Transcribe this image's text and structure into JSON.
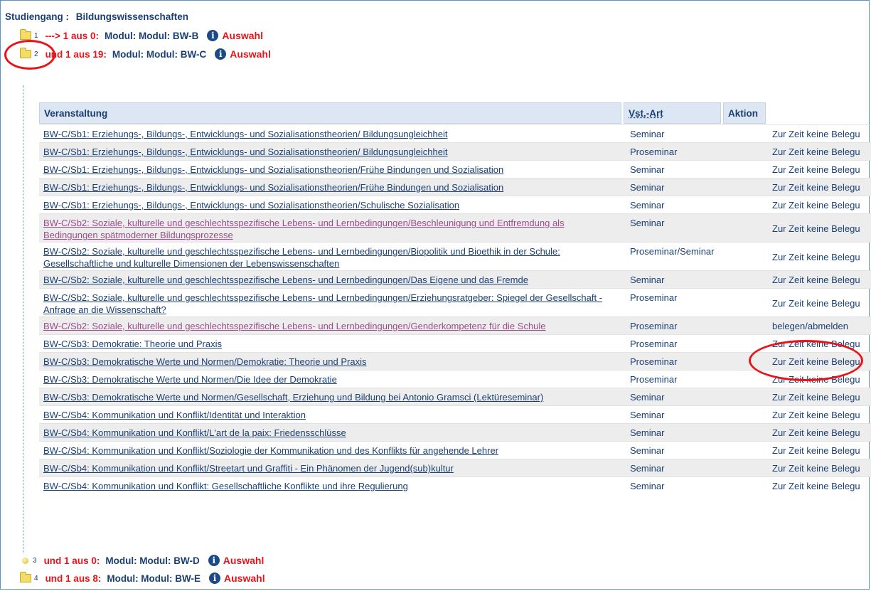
{
  "studiengang": {
    "label": "Studiengang :",
    "value": "Bildungswissenschaften"
  },
  "modules_top": [
    {
      "num": "1",
      "icon": "folder-icon",
      "condition": "---> 1 aus 0:",
      "text": "Modul:  Modul:  BW-B",
      "action": "Auswahl"
    },
    {
      "num": "2",
      "icon": "folder-icon",
      "condition": "und 1 aus 19:",
      "text": "Modul:  Modul:  BW-C",
      "action": "Auswahl"
    }
  ],
  "table": {
    "headers": {
      "veranstaltung": "Veranstaltung",
      "art": "Vst.-Art",
      "aktion": "Aktion"
    },
    "rows": [
      {
        "title": "BW-C/Sb1: Erziehungs-, Bildungs-, Entwicklungs- und Sozialisationstheorien/ Bildungsungleichheit",
        "art": "Seminar",
        "status": "Zur Zeit keine Belegu",
        "visited": false
      },
      {
        "title": "BW-C/Sb1: Erziehungs-, Bildungs-, Entwicklungs- und Sozialisationstheorien/ Bildungsungleichheit",
        "art": "Proseminar",
        "status": "Zur Zeit keine Belegu",
        "visited": false
      },
      {
        "title": "BW-C/Sb1: Erziehungs-, Bildungs-, Entwicklungs- und Sozialisationstheorien/Frühe Bindungen und Sozialisation",
        "art": "Seminar",
        "status": "Zur Zeit keine Belegu",
        "visited": false
      },
      {
        "title": "BW-C/Sb1: Erziehungs-, Bildungs-, Entwicklungs- und Sozialisationstheorien/Frühe Bindungen und Sozialisation",
        "art": "Seminar",
        "status": "Zur Zeit keine Belegu",
        "visited": false
      },
      {
        "title": "BW-C/Sb1: Erziehungs-, Bildungs-, Entwicklungs- und Sozialisationstheorien/Schulische Sozialisation",
        "art": "Seminar",
        "status": "Zur Zeit keine Belegu",
        "visited": false
      },
      {
        "title": "BW-C/Sb2: Soziale, kulturelle und geschlechtsspezifische Lebens- und Lernbedingungen/Beschleunigung und Entfremdung als Bedingungen spätmoderner Bildungsprozesse",
        "art": "Seminar",
        "status": "Zur Zeit keine Belegu",
        "visited": true
      },
      {
        "title": "BW-C/Sb2: Soziale, kulturelle und geschlechtsspezifische Lebens- und Lernbedingungen/Biopolitik und Bioethik in der Schule: Gesellschaftliche und kulturelle Dimensionen der Lebenswissenschaften",
        "art": "Proseminar/Seminar",
        "status": "Zur Zeit keine Belegu",
        "visited": false
      },
      {
        "title": "BW-C/Sb2: Soziale, kulturelle und geschlechtsspezifische Lebens- und Lernbedingungen/Das Eigene und das Fremde",
        "art": "Seminar",
        "status": "Zur Zeit keine Belegu",
        "visited": false
      },
      {
        "title": "BW-C/Sb2: Soziale, kulturelle und geschlechtsspezifische Lebens- und Lernbedingungen/Erziehungsratgeber: Spiegel der Gesellschaft - Anfrage an die Wissenschaft?",
        "art": "Proseminar",
        "status": "Zur Zeit keine Belegu",
        "visited": false
      },
      {
        "title": "BW-C/Sb2: Soziale, kulturelle und geschlechtsspezifische Lebens- und Lernbedingungen/Genderkompetenz für die Schule",
        "art": "Proseminar",
        "status": "belegen/abmelden",
        "visited": true
      },
      {
        "title": "BW-C/Sb3: Demokratie: Theorie und Praxis",
        "art": "Proseminar",
        "status": "Zur Zeit keine Belegu",
        "visited": false
      },
      {
        "title": "BW-C/Sb3: Demokratische Werte und Normen/Demokratie: Theorie und Praxis",
        "art": "Proseminar",
        "status": "Zur Zeit keine Belegu",
        "visited": false
      },
      {
        "title": "BW-C/Sb3: Demokratische Werte und Normen/Die Idee der Demokratie",
        "art": "Proseminar",
        "status": "Zur Zeit keine Belegu",
        "visited": false
      },
      {
        "title": "BW-C/Sb3: Demokratische Werte und Normen/Gesellschaft, Erziehung und Bildung bei Antonio Gramsci (Lektüreseminar)",
        "art": "Seminar",
        "status": "Zur Zeit keine Belegu",
        "visited": false
      },
      {
        "title": "BW-C/Sb4: Kommunikation und Konflikt/Identität und Interaktion",
        "art": "Seminar",
        "status": "Zur Zeit keine Belegu",
        "visited": false
      },
      {
        "title": "BW-C/Sb4: Kommunikation und Konflikt/L'art de la paix: Friedensschlüsse",
        "art": "Seminar",
        "status": "Zur Zeit keine Belegu",
        "visited": false
      },
      {
        "title": "BW-C/Sb4: Kommunikation und Konflikt/Soziologie der Kommunikation und des Konflikts für angehende Lehrer",
        "art": "Seminar",
        "status": "Zur Zeit keine Belegu",
        "visited": false
      },
      {
        "title": "BW-C/Sb4: Kommunikation und Konflikt/Streetart und Graffiti - Ein Phänomen der Jugend(sub)kultur",
        "art": "Seminar",
        "status": "Zur Zeit keine Belegu",
        "visited": false
      },
      {
        "title": "BW-C/Sb4: Kommunikation und Konflikt: Gesellschaftliche Konflikte und ihre Regulierung",
        "art": "Seminar",
        "status": "Zur Zeit keine Belegu",
        "visited": false
      }
    ]
  },
  "modules_bottom": [
    {
      "num": "3",
      "icon": "dot-icon",
      "condition": "und 1 aus 0:",
      "text": "Modul:  Modul:  BW-D",
      "action": "Auswahl"
    },
    {
      "num": "4",
      "icon": "folder-icon",
      "condition": "und 1 aus 8:",
      "text": "Modul:  Modul:  BW-E",
      "action": "Auswahl"
    }
  ],
  "colors": {
    "link": "#1b3f73",
    "visited_link": "#9a4d89",
    "red": "#e8141a",
    "header_bg": "#dde6f3"
  }
}
